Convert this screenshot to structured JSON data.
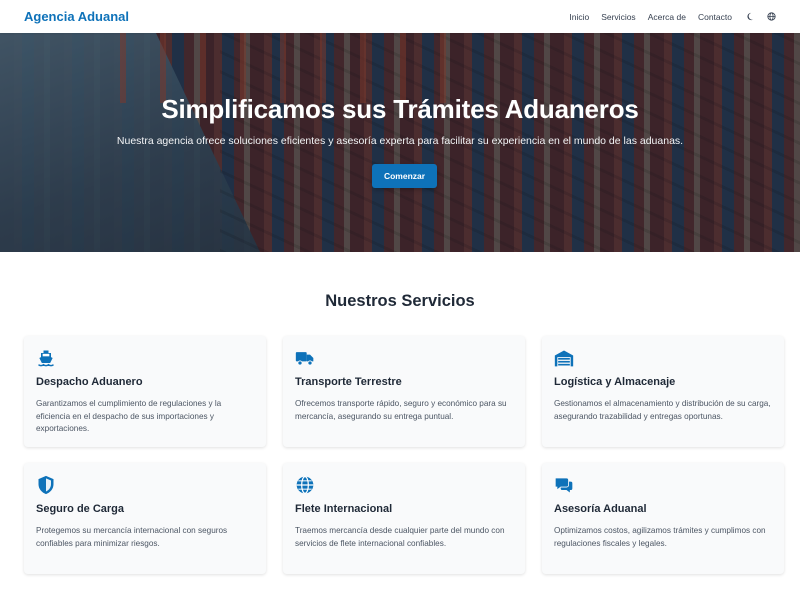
{
  "header": {
    "brand": "Agencia Aduanal",
    "nav": [
      "Inicio",
      "Servicios",
      "Acerca de",
      "Contacto"
    ],
    "icons": [
      "moon-icon",
      "globe-icon"
    ]
  },
  "hero": {
    "title": "Simplificamos sus Trámites Aduaneros",
    "subtitle": "Nuestra agencia ofrece soluciones eficientes y asesoría experta para facilitar su experiencia en el mundo de las aduanas.",
    "cta": "Comenzar"
  },
  "services": {
    "title": "Nuestros Servicios",
    "items": [
      {
        "icon": "ship-icon",
        "title": "Despacho Aduanero",
        "desc": "Garantizamos el cumplimiento de regulaciones y la eficiencia en el despacho de sus importaciones y exportaciones."
      },
      {
        "icon": "truck-icon",
        "title": "Transporte Terrestre",
        "desc": "Ofrecemos transporte rápido, seguro y económico para su mercancía, asegurando su entrega puntual."
      },
      {
        "icon": "warehouse-icon",
        "title": "Logística y Almacenaje",
        "desc": "Gestionamos el almacenamiento y distribución de su carga, asegurando trazabilidad y entregas oportunas."
      },
      {
        "icon": "shield-icon",
        "title": "Seguro de Carga",
        "desc": "Protegemos su mercancía internacional con seguros confiables para minimizar riesgos."
      },
      {
        "icon": "globe-icon",
        "title": "Flete Internacional",
        "desc": "Traemos mercancía desde cualquier parte del mundo con servicios de flete internacional confiables."
      },
      {
        "icon": "chat-icon",
        "title": "Asesoría Aduanal",
        "desc": "Optimizamos costos, agilizamos trámites y cumplimos con regulaciones fiscales y legales."
      }
    ]
  },
  "colors": {
    "accent": "#0e72b9",
    "text": "#1f2937",
    "card_bg": "#f9fafb"
  }
}
